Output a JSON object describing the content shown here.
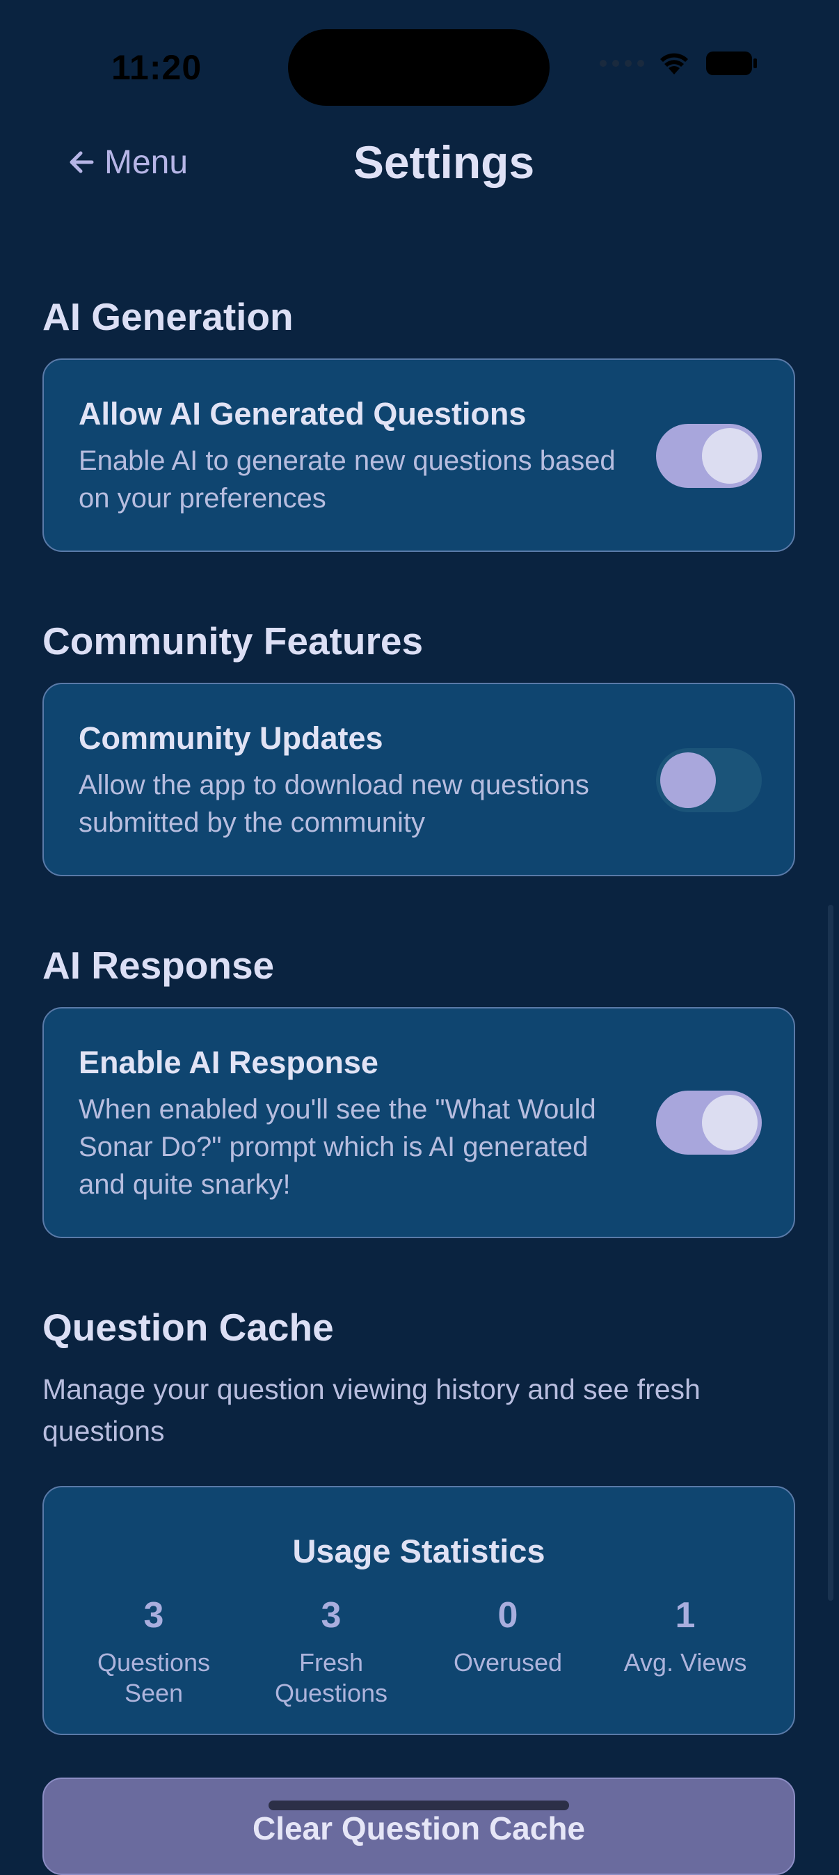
{
  "status_bar": {
    "time": "11:20"
  },
  "header": {
    "back_label": "Menu",
    "title": "Settings"
  },
  "sections": {
    "ai_generation": {
      "heading": "AI Generation",
      "setting_title": "Allow AI Generated Questions",
      "setting_desc": "Enable AI to generate new questions based on your preferences",
      "toggle_on": true
    },
    "community": {
      "heading": "Community Features",
      "setting_title": "Community Updates",
      "setting_desc": "Allow the app to download new questions submitted by the community",
      "toggle_on": false
    },
    "ai_response": {
      "heading": "AI Response",
      "setting_title": "Enable AI Response",
      "setting_desc": "When enabled you'll see the \"What Would Sonar Do?\" prompt which is AI generated and quite snarky!",
      "toggle_on": true
    },
    "question_cache": {
      "heading": "Question Cache",
      "description": "Manage your question viewing history and see fresh questions",
      "stats_title": "Usage Statistics",
      "stats": [
        {
          "value": "3",
          "label": "Questions Seen"
        },
        {
          "value": "3",
          "label": "Fresh Questions"
        },
        {
          "value": "0",
          "label": "Overused"
        },
        {
          "value": "1",
          "label": "Avg. Views"
        }
      ],
      "clear_button_label": "Clear Question Cache"
    }
  },
  "colors": {
    "background": "#0a2340",
    "card": "#0f4570",
    "accent": "#a8a6dc"
  }
}
